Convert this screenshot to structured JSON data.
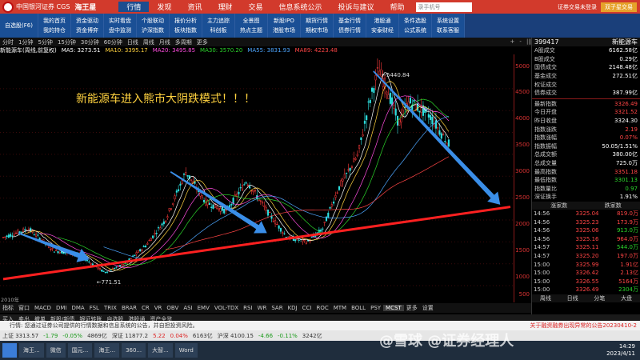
{
  "titlebar": {
    "brand": "中国银河证券 CGS",
    "app_name": "海王星",
    "menu": [
      "行情",
      "发现",
      "资讯",
      "理财",
      "交易",
      "信息系统公示",
      "投诉与建议",
      "帮助"
    ],
    "active_menu": "行情",
    "search_placeholder": "录手机号",
    "right_items": [
      "证券交易未登录"
    ],
    "trade_button": "双子星交易"
  },
  "toolbar": {
    "items": [
      [
        "自选股(F6)"
      ],
      [
        "我的首页",
        "我的持仓"
      ],
      [
        "资金驱动",
        "资金博弈"
      ],
      [
        "实时看盘",
        "盘中监测"
      ],
      [
        "个股联动",
        "沪深指数"
      ],
      [
        "报价分析",
        "板块指数"
      ],
      [
        "主力追踪",
        "科创板"
      ],
      [
        "全景图",
        "热点主题"
      ],
      [
        "新股IPO",
        "港股市场"
      ],
      [
        "期货行情",
        "期权市场"
      ],
      [
        "基金行情",
        "债券行情"
      ],
      [
        "港股通",
        "安泰财经"
      ],
      [
        "条件选股",
        "公式系统"
      ],
      [
        "系统设置",
        "联系客服"
      ]
    ]
  },
  "tabrow": {
    "tabs": [
      "分时",
      "1分钟",
      "5分钟",
      "15分钟",
      "30分钟",
      "60分钟",
      "日线",
      "周线",
      "月线",
      "多周期",
      "更多"
    ],
    "tools": [
      "+",
      "-",
      "|||",
      "叠加",
      "统计",
      "画线",
      "F10",
      "标记",
      "-",
      "□",
      "×"
    ]
  },
  "ma_row": {
    "name": "新能源车(周线,前复权)",
    "items": [
      {
        "label": "MA5: 3273.51",
        "color": "#ffffff"
      },
      {
        "label": "MA10: 3395.17",
        "color": "#ffd23f"
      },
      {
        "label": "MA20: 3495.85",
        "color": "#ff4de0"
      },
      {
        "label": "MA30: 3570.20",
        "color": "#2bd42b"
      },
      {
        "label": "MA55: 3831.93",
        "color": "#4da6ff"
      },
      {
        "label": "MA89: 4223.48",
        "color": "#ff4545"
      }
    ]
  },
  "annotation": "新能源车进入熊市大阴跌模式！！！",
  "high_label": "5440.84",
  "low_label": "771.51",
  "x_start_label": "2010年",
  "chart_data": {
    "type": "candlestick",
    "title": "新能源车(周线,前复权)",
    "yticks": [
      500,
      1000,
      1500,
      2000,
      2500,
      3000,
      3500,
      4000,
      4500,
      5000
    ],
    "ylim": [
      300,
      5600
    ],
    "series": [
      {
        "name": "price_path",
        "x": [
          0,
          5,
          10,
          15,
          20,
          24,
          28,
          32,
          36,
          40,
          44,
          48,
          52,
          56,
          60,
          63,
          66,
          70,
          72,
          74,
          76,
          78,
          80,
          84,
          88,
          92,
          96,
          100
        ],
        "values": [
          1600,
          1800,
          1300,
          1200,
          800,
          1000,
          1400,
          2000,
          3100,
          2400,
          2200,
          2900,
          2200,
          1600,
          1500,
          1800,
          2700,
          3500,
          4600,
          5440,
          4900,
          4200,
          4700,
          4400,
          3700,
          null,
          null,
          null
        ]
      }
    ],
    "annotations": [
      {
        "text": "5440.84",
        "type": "high"
      },
      {
        "text": "771.51",
        "type": "low"
      }
    ],
    "trendline": {
      "color": "#ff2020",
      "from": [
        0,
        650
      ],
      "to": [
        100,
        2300
      ]
    },
    "arrows": [
      {
        "from": [
          3,
          1700
        ],
        "to": [
          17,
          1100
        ],
        "color": "#3a8ee8"
      },
      {
        "from": [
          33,
          3100
        ],
        "to": [
          52,
          1700
        ],
        "color": "#3a8ee8"
      },
      {
        "from": [
          73,
          5400
        ],
        "to": [
          98,
          2350
        ],
        "color": "#3a8ee8"
      }
    ]
  },
  "yaxis": [
    "5000",
    "4500",
    "4000",
    "3500",
    "3000",
    "2500",
    "2000",
    "1500",
    "1000",
    "500"
  ],
  "indicators": [
    "指标",
    "窗口",
    "MACD",
    "DMI",
    "DMA",
    "FSL",
    "TRIX",
    "BRAR",
    "CR",
    "VR",
    "OBV",
    "ASI",
    "EMV",
    "VOL-TDX",
    "RSI",
    "WR",
    "SAR",
    "KDJ",
    "CCI",
    "ROC",
    "MTM",
    "BOLL",
    "PSY",
    "MCST",
    "更多",
    "设置"
  ],
  "indicator_active": "MCST",
  "panel": {
    "title_code": "399417",
    "title_name": "新能源车",
    "stats": [
      {
        "k": "A股成交",
        "v": "6162.58亿",
        "c": ""
      },
      {
        "k": "B股成交",
        "v": "0.29亿",
        "c": ""
      },
      {
        "k": "国债成交",
        "v": "2148.48亿",
        "c": ""
      },
      {
        "k": "基金成交",
        "v": "272.51亿",
        "c": ""
      },
      {
        "k": "权证成交",
        "v": "",
        "c": ""
      },
      {
        "k": "债券成交",
        "v": "387.99亿",
        "c": ""
      }
    ],
    "quote": [
      {
        "k": "最新指数",
        "v": "3326.49",
        "c": "red"
      },
      {
        "k": "今日开盘",
        "v": "3321.52",
        "c": "red"
      },
      {
        "k": "昨日收盘",
        "v": "3324.30",
        "c": ""
      },
      {
        "k": "指数涨跌",
        "v": "2.19",
        "c": "red"
      },
      {
        "k": "指数涨幅",
        "v": "0.07%",
        "c": "red"
      },
      {
        "k": "指数振幅",
        "v": "50.05/1.51%",
        "c": ""
      },
      {
        "k": "总成交额",
        "v": "380.00亿",
        "c": ""
      },
      {
        "k": "总成交量",
        "v": "725.0万",
        "c": ""
      },
      {
        "k": "最高指数",
        "v": "3351.18",
        "c": "red"
      },
      {
        "k": "最低指数",
        "v": "3301.13",
        "c": "green"
      },
      {
        "k": "指数量比",
        "v": "0.97",
        "c": "green"
      },
      {
        "k": "深证换手",
        "v": "1.91%",
        "c": ""
      }
    ],
    "tick_header": [
      "涨家数",
      "跌家数"
    ],
    "ticks": [
      {
        "t": "14:56",
        "p": "3325.04",
        "vol": "819.0万",
        "vc": "red"
      },
      {
        "t": "14:56",
        "p": "3325.23",
        "vol": "173.9万",
        "vc": "red"
      },
      {
        "t": "14:56",
        "p": "3325.06",
        "vol": "913.0万",
        "vc": "green"
      },
      {
        "t": "14:56",
        "p": "3325.16",
        "vol": "964.0万",
        "vc": "red"
      },
      {
        "t": "14:57",
        "p": "3325.11",
        "vol": "544.0万",
        "vc": "green"
      },
      {
        "t": "14:57",
        "p": "3325.20",
        "vol": "197.0万",
        "vc": "red"
      },
      {
        "t": "15:00",
        "p": "3325.99",
        "vol": "1.91亿",
        "vc": "red"
      },
      {
        "t": "15:00",
        "p": "3326.42",
        "vol": "2.13亿",
        "vc": "red"
      },
      {
        "t": "15:00",
        "p": "3326.55",
        "vol": "5164万",
        "vc": "red"
      },
      {
        "t": "15:00",
        "p": "3326.49",
        "vol": "2304万",
        "vc": "green"
      }
    ],
    "subtabs": [
      "周线",
      "日线",
      "分笔",
      "大盘"
    ]
  },
  "funcrow": [
    "买入",
    "卖出",
    "撤单",
    "新股/新债",
    "银证转账",
    "自选股",
    "港股通",
    "资产全览"
  ],
  "tradebar": {
    "notice": "行情:  您通过证券公司提供的行情数据和信息系统的公告，并自担投资风险。",
    "news": "关于融资融券出现异常的公告20230410-2"
  },
  "statusbar": [
    {
      "text": "上证 3313.57",
      "c": ""
    },
    {
      "text": "-1.79",
      "c": "green"
    },
    {
      "text": "-0.05%",
      "c": "green"
    },
    {
      "text": "4869亿",
      "c": ""
    },
    {
      "text": "深证 11877.2",
      "c": ""
    },
    {
      "text": "5.22",
      "c": "red"
    },
    {
      "text": "0.04%",
      "c": "red"
    },
    {
      "text": "6163亿",
      "c": ""
    },
    {
      "text": "沪深 4100.15",
      "c": ""
    },
    {
      "text": "-4.66",
      "c": "green"
    },
    {
      "text": "-0.11%",
      "c": "green"
    },
    {
      "text": "3242亿",
      "c": ""
    }
  ],
  "taskbar": {
    "tasks": [
      "海王...",
      "微信",
      "国元...",
      "海王...",
      "360...",
      "大智...",
      "Word"
    ],
    "clock_time": "14:29",
    "clock_date": "2023/4/11"
  },
  "watermark": "@雪球 @证券经理人"
}
